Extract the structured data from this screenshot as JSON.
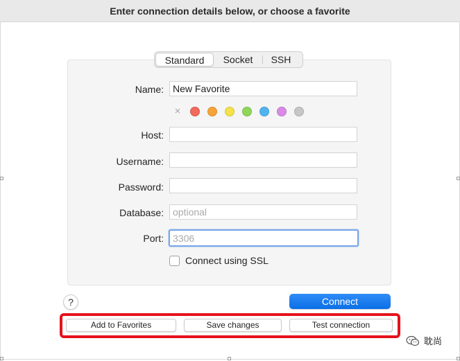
{
  "header": {
    "title": "Enter connection details below, or choose a favorite"
  },
  "tabs": [
    {
      "label": "Standard",
      "selected": true
    },
    {
      "label": "Socket",
      "selected": false
    },
    {
      "label": "SSH",
      "selected": false
    }
  ],
  "form": {
    "name": {
      "label": "Name:",
      "value": "New Favorite"
    },
    "host": {
      "label": "Host:",
      "value": ""
    },
    "username": {
      "label": "Username:",
      "value": ""
    },
    "password": {
      "label": "Password:",
      "value": ""
    },
    "database": {
      "label": "Database:",
      "value": "",
      "placeholder": "optional"
    },
    "port": {
      "label": "Port:",
      "value": "",
      "placeholder": "3306"
    }
  },
  "colors": {
    "clear_icon": "×",
    "swatches": [
      "#f26a5b",
      "#f6a33a",
      "#f5e14a",
      "#8fd65a",
      "#4fb3f0",
      "#d98ae6",
      "#c6c6c6"
    ]
  },
  "ssl": {
    "label": "Connect using SSL",
    "checked": false
  },
  "buttons": {
    "help": "?",
    "connect": "Connect",
    "add_to_favorites": "Add to Favorites",
    "save_changes": "Save changes",
    "test_connection": "Test connection"
  },
  "watermark": {
    "text": "耽尚",
    "icon": "wechat-icon"
  },
  "accent": {
    "primary": "#0b6fe6",
    "highlight_box": "#e5121b"
  }
}
